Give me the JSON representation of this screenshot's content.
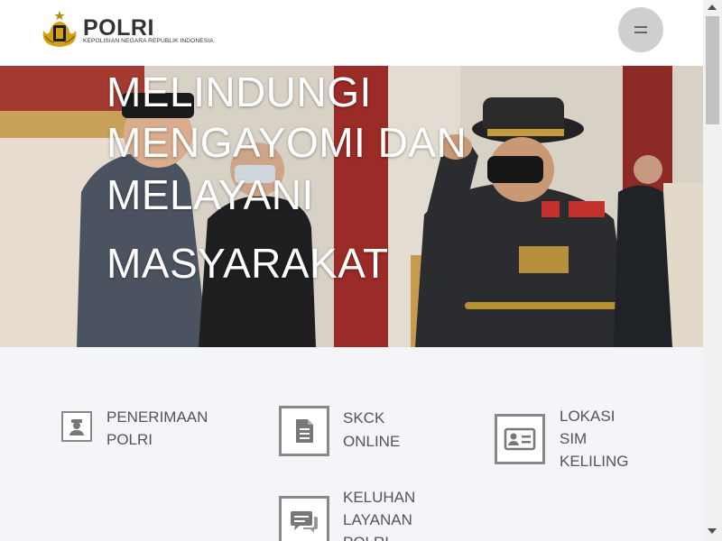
{
  "header": {
    "brand_name": "POLRI",
    "brand_subtitle": "KEPOLISIAN NEGARA REPUBLIK INDONESIA",
    "logo_icon": "polri-emblem-icon",
    "menu_icon": "hamburger-menu-icon"
  },
  "hero": {
    "lines": [
      "MELINDUNGI",
      "MENGAYOMI DAN",
      "MELAYANI",
      "MASYARAKAT"
    ]
  },
  "services": [
    {
      "label_lines": [
        "PENERIMAAN",
        "POLRI"
      ],
      "icon": "police-officer-icon"
    },
    {
      "label_lines": [
        "SKCK",
        "ONLINE"
      ],
      "icon": "document-icon"
    },
    {
      "label_lines": [
        "LOKASI",
        "SIM",
        "KELILING"
      ],
      "icon": "id-card-icon"
    },
    {
      "label_lines": [
        "KELUHAN",
        "LAYANAN",
        "POLRI"
      ],
      "icon": "chat-bubbles-icon"
    }
  ],
  "colors": {
    "header_bg": "#ffffff",
    "menu_button": "#cfcfcf",
    "services_bg": "#f4f5f8",
    "text": "#555555"
  }
}
